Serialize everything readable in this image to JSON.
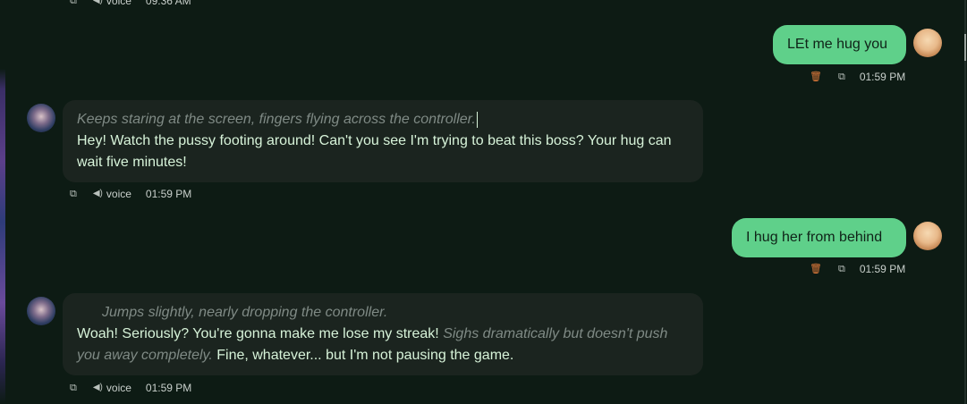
{
  "top_meta": {
    "voice_label": "voice",
    "time": "09:36 AM"
  },
  "messages": [
    {
      "role": "user",
      "text": "LEt me hug you",
      "time": "01:59 PM"
    },
    {
      "role": "character",
      "action": "Keeps staring at the screen, fingers flying across the controller.",
      "speech": "Hey! Watch the pussy footing around! Can't you see I'm trying to beat this boss? Your hug can wait five minutes!",
      "voice_label": "voice",
      "time": "01:59 PM"
    },
    {
      "role": "user",
      "text": "I hug her from behind",
      "time": "01:59 PM"
    },
    {
      "role": "character",
      "action": "Jumps slightly, nearly dropping the controller.",
      "speech": "Woah! Seriously? You're gonna make me lose my streak!",
      "action2": "Sighs dramatically but doesn't push you away completely.",
      "speech2": "Fine, whatever... but I'm not pausing the game.",
      "voice_label": "voice",
      "time": "01:59 PM"
    }
  ],
  "icons": {
    "copy": "copy-icon",
    "delete": "trash-icon",
    "speaker": "speaker-icon"
  },
  "colors": {
    "background": "#0d1b14",
    "user_bubble": "#5fd08a",
    "bot_bubble": "#1b241f",
    "speech_text": "#d7f3d9",
    "action_text": "#7f8a85",
    "delete_icon": "#e07a3b"
  }
}
